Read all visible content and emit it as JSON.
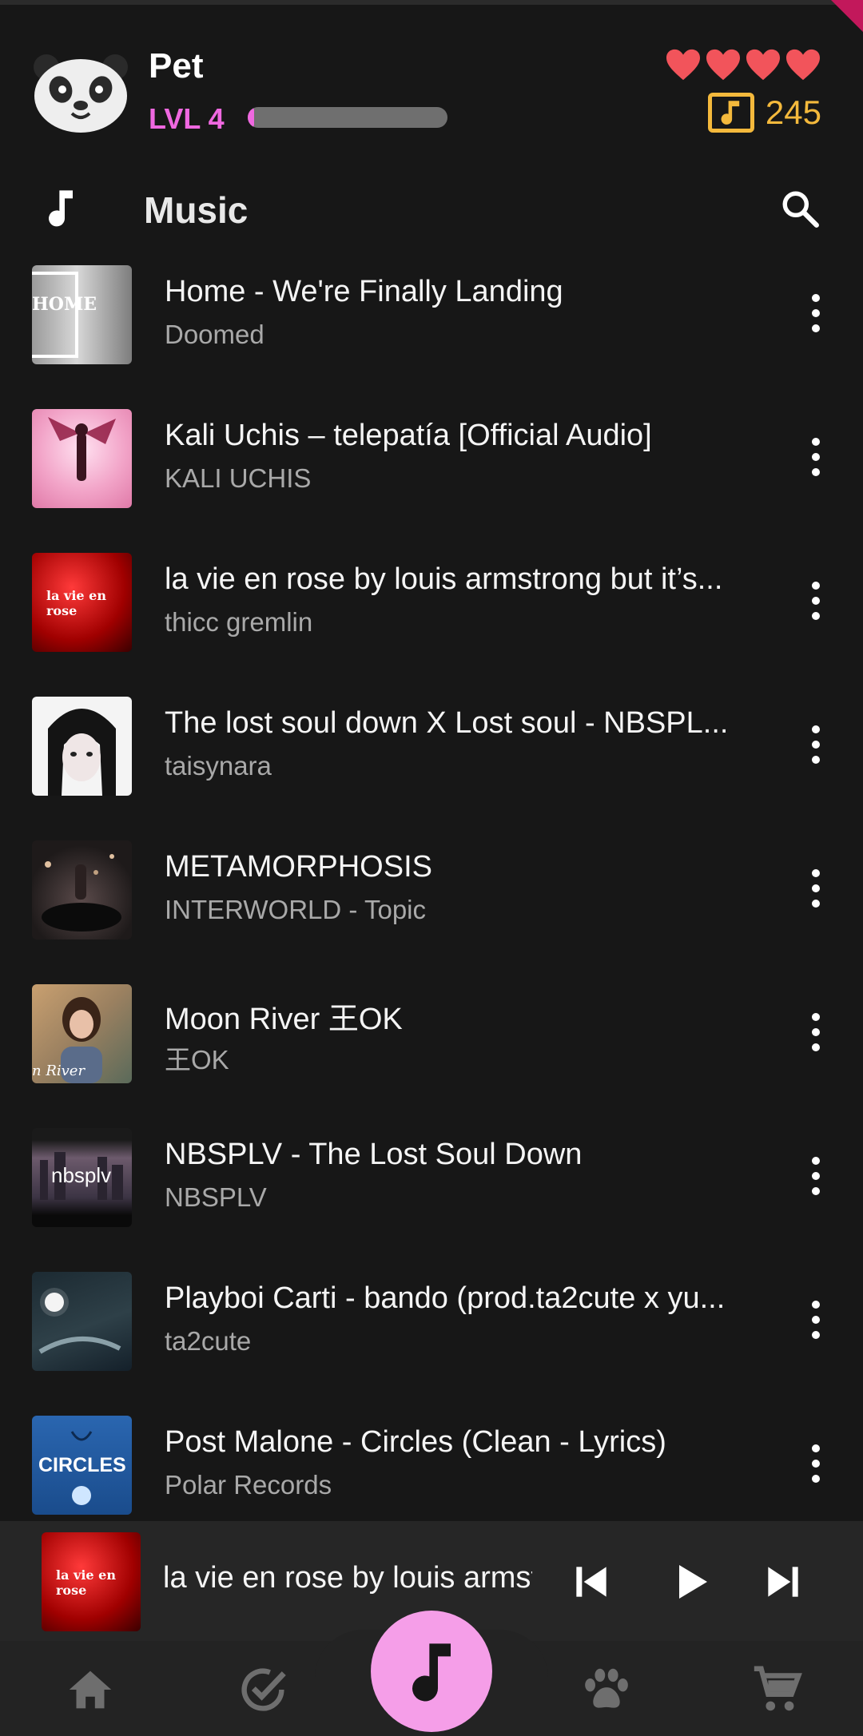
{
  "pet": {
    "name": "Pet",
    "level_label": "LVL 4",
    "xp_progress": 0.03,
    "hearts": 4,
    "coins": "245"
  },
  "section": {
    "title": "Music",
    "icon": "music-note-icon"
  },
  "tracks": [
    {
      "title": "Home - We're Finally Landing",
      "artist": "Doomed",
      "thumb_text": "HOME"
    },
    {
      "title": "Kali Uchis – telepatía [Official Audio]",
      "artist": "KALI UCHIS",
      "thumb_text": ""
    },
    {
      "title": "la vie en rose by louis armstrong but it’s...",
      "artist": "thicc gremlin",
      "thumb_text": "la vie en rose"
    },
    {
      "title": "The lost soul down X Lost soul - NBSPL...",
      "artist": "taisynara",
      "thumb_text": ""
    },
    {
      "title": "METAMORPHOSIS",
      "artist": "INTERWORLD - Topic",
      "thumb_text": ""
    },
    {
      "title": "Moon River  王OK",
      "artist": "王OK",
      "thumb_text": "n River"
    },
    {
      "title": "NBSPLV - The Lost Soul Down",
      "artist": "NBSPLV",
      "thumb_text": "nbsplv"
    },
    {
      "title": "Playboi Carti - bando (prod.ta2cute x yu...",
      "artist": "ta2cute",
      "thumb_text": ""
    },
    {
      "title": "Post Malone - Circles (Clean - Lyrics)",
      "artist": "Polar Records",
      "thumb_text": "CIRCLES"
    }
  ],
  "now_playing": {
    "title": "la vie en rose by louis armstrong but it’s",
    "thumb_text": "la vie en rose"
  },
  "nav": [
    "home-icon",
    "check-circle-icon",
    "music-note-icon",
    "paw-icon",
    "cart-icon"
  ],
  "colors": {
    "accent_pink": "#ef68e0",
    "fab_pink": "#f59ee8",
    "coin_gold": "#f4b93c",
    "heart_red": "#f2545b",
    "background": "#171717"
  }
}
